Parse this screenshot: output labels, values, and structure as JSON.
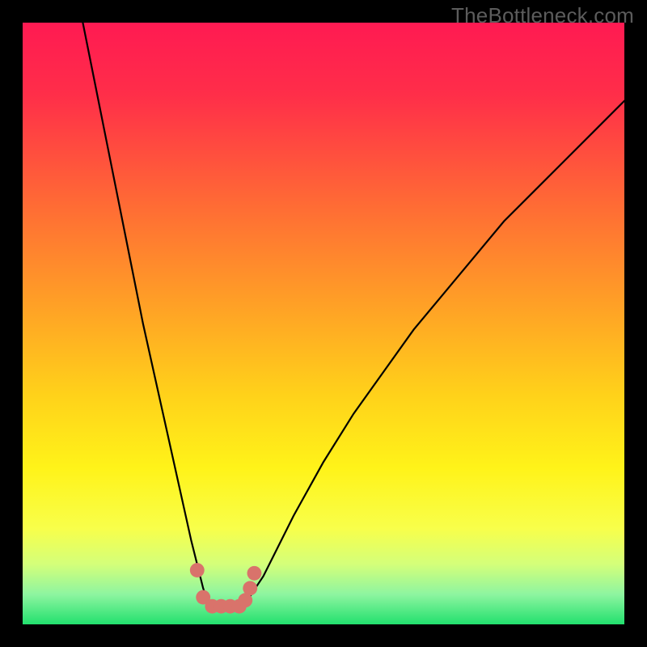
{
  "watermark": "TheBottleneck.com",
  "gradient_stops": [
    {
      "offset": 0.0,
      "color": "#ff1a52"
    },
    {
      "offset": 0.12,
      "color": "#ff2e49"
    },
    {
      "offset": 0.3,
      "color": "#ff6a35"
    },
    {
      "offset": 0.48,
      "color": "#ffa425"
    },
    {
      "offset": 0.62,
      "color": "#ffd21a"
    },
    {
      "offset": 0.74,
      "color": "#fff319"
    },
    {
      "offset": 0.84,
      "color": "#f8ff4a"
    },
    {
      "offset": 0.9,
      "color": "#d4ff7a"
    },
    {
      "offset": 0.95,
      "color": "#8ef5a0"
    },
    {
      "offset": 1.0,
      "color": "#22e06e"
    }
  ],
  "chart_data": {
    "type": "line",
    "title": "",
    "xlabel": "",
    "ylabel": "",
    "xlim": [
      0,
      100
    ],
    "ylim": [
      0,
      100
    ],
    "description": "Bottleneck curve overlaid on red→green vertical gradient; y=0 (bottom) means no bottleneck (green), y=100 means severe (red). The curve descends steeply from the top-left, reaches a flat minimum around x≈31–37 at y≈3, then rises with decreasing slope toward the top-right.",
    "series": [
      {
        "name": "bottleneck-curve",
        "x": [
          10,
          12,
          14,
          16,
          18,
          20,
          22,
          24,
          26,
          28,
          29,
          30,
          31,
          33,
          35,
          37,
          38,
          40,
          42,
          45,
          50,
          55,
          60,
          65,
          70,
          75,
          80,
          85,
          90,
          95,
          100
        ],
        "y": [
          100,
          90,
          80,
          70,
          60,
          50,
          41,
          32,
          23,
          14,
          10,
          6,
          3,
          3,
          3,
          3,
          5,
          8,
          12,
          18,
          27,
          35,
          42,
          49,
          55,
          61,
          67,
          72,
          77,
          82,
          87
        ]
      }
    ],
    "markers": {
      "name": "near-minimum-dots",
      "color": "#d9736b",
      "radius_pct": 1.2,
      "points": [
        {
          "x": 29.0,
          "y": 9.0
        },
        {
          "x": 30.0,
          "y": 4.5
        },
        {
          "x": 31.5,
          "y": 3.0
        },
        {
          "x": 33.0,
          "y": 3.0
        },
        {
          "x": 34.5,
          "y": 3.0
        },
        {
          "x": 36.0,
          "y": 3.0
        },
        {
          "x": 37.0,
          "y": 4.0
        },
        {
          "x": 37.8,
          "y": 6.0
        },
        {
          "x": 38.5,
          "y": 8.5
        }
      ]
    }
  }
}
